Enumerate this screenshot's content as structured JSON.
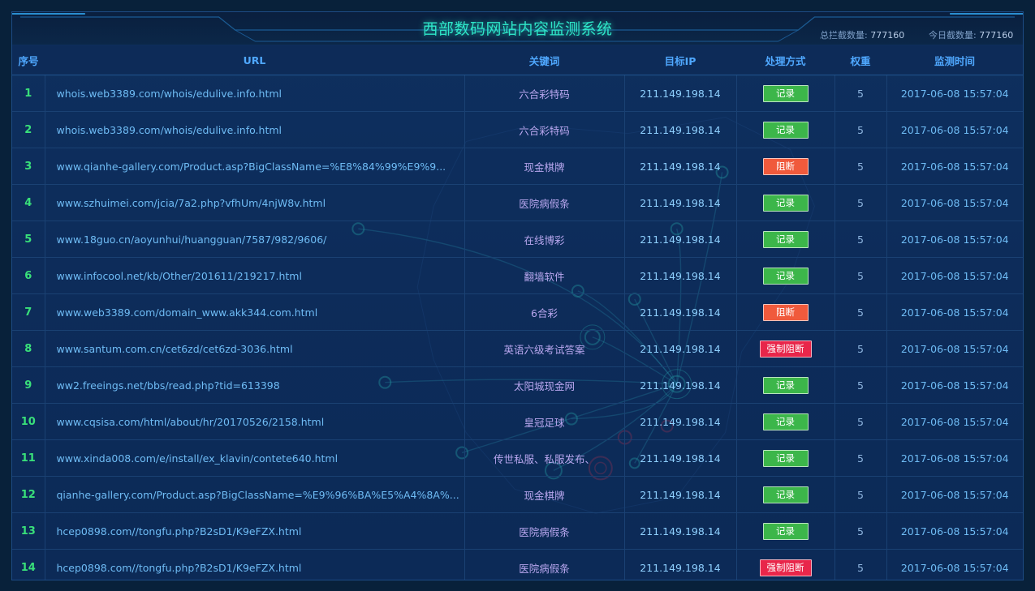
{
  "header": {
    "title": "西部数码网站内容监测系统",
    "total_label": "总拦截数量:",
    "total_value": "777160",
    "today_label": "今日截数量:",
    "today_value": "777160"
  },
  "table": {
    "columns": [
      "序号",
      "URL",
      "关键词",
      "目标IP",
      "处理方式",
      "权重",
      "监测时间"
    ],
    "rows": [
      {
        "no": "1",
        "url": "whois.web3389.com/whois/edulive.info.html",
        "keyword": "六合彩特码",
        "ip": "211.149.198.14",
        "action": "记录",
        "action_type": "record",
        "weight": "5",
        "time": "2017-06-08 15:57:04"
      },
      {
        "no": "2",
        "url": "whois.web3389.com/whois/edulive.info.html",
        "keyword": "六合彩特码",
        "ip": "211.149.198.14",
        "action": "记录",
        "action_type": "record",
        "weight": "5",
        "time": "2017-06-08 15:57:04"
      },
      {
        "no": "3",
        "url": "www.qianhe-gallery.com/Product.asp?BigClassName=%E8%84%99%E9%9...",
        "keyword": "现金棋牌",
        "ip": "211.149.198.14",
        "action": "阻断",
        "action_type": "block",
        "weight": "5",
        "time": "2017-06-08 15:57:04"
      },
      {
        "no": "4",
        "url": "www.szhuimei.com/jcia/7a2.php?vfhUm/4njW8v.html",
        "keyword": "医院病假条",
        "ip": "211.149.198.14",
        "action": "记录",
        "action_type": "record",
        "weight": "5",
        "time": "2017-06-08 15:57:04"
      },
      {
        "no": "5",
        "url": "www.18guo.cn/aoyunhui/huangguan/7587/982/9606/",
        "keyword": "在线博彩",
        "ip": "211.149.198.14",
        "action": "记录",
        "action_type": "record",
        "weight": "5",
        "time": "2017-06-08 15:57:04"
      },
      {
        "no": "6",
        "url": "www.infocool.net/kb/Other/201611/219217.html",
        "keyword": "翻墙软件",
        "ip": "211.149.198.14",
        "action": "记录",
        "action_type": "record",
        "weight": "5",
        "time": "2017-06-08 15:57:04"
      },
      {
        "no": "7",
        "url": "www.web3389.com/domain_www.akk344.com.html",
        "keyword": "6合彩",
        "ip": "211.149.198.14",
        "action": "阻断",
        "action_type": "block",
        "weight": "5",
        "time": "2017-06-08 15:57:04"
      },
      {
        "no": "8",
        "url": "www.santum.com.cn/cet6zd/cet6zd-3036.html",
        "keyword": "英语六级考试答案",
        "ip": "211.149.198.14",
        "action": "强制阻断",
        "action_type": "force",
        "weight": "5",
        "time": "2017-06-08 15:57:04"
      },
      {
        "no": "9",
        "url": "ww2.freeings.net/bbs/read.php?tid=613398",
        "keyword": "太阳城现金网",
        "ip": "211.149.198.14",
        "action": "记录",
        "action_type": "record",
        "weight": "5",
        "time": "2017-06-08 15:57:04"
      },
      {
        "no": "10",
        "url": "www.cqsisa.com/html/about/hr/20170526/2158.html",
        "keyword": "皇冠足球",
        "ip": "211.149.198.14",
        "action": "记录",
        "action_type": "record",
        "weight": "5",
        "time": "2017-06-08 15:57:04"
      },
      {
        "no": "11",
        "url": "www.xinda008.com/e/install/ex_klavin/contete640.html",
        "keyword": "传世私服、私服发布、",
        "ip": "211.149.198.14",
        "action": "记录",
        "action_type": "record",
        "weight": "5",
        "time": "2017-06-08 15:57:04"
      },
      {
        "no": "12",
        "url": "qianhe-gallery.com/Product.asp?BigClassName=%E9%96%BA%E5%A4%8A%...",
        "keyword": "现金棋牌",
        "ip": "211.149.198.14",
        "action": "记录",
        "action_type": "record",
        "weight": "5",
        "time": "2017-06-08 15:57:04"
      },
      {
        "no": "13",
        "url": "hcep0898.com//tongfu.php?B2sD1/K9eFZX.html",
        "keyword": "医院病假条",
        "ip": "211.149.198.14",
        "action": "记录",
        "action_type": "record",
        "weight": "5",
        "time": "2017-06-08 15:57:04"
      },
      {
        "no": "14",
        "url": "hcep0898.com//tongfu.php?B2sD1/K9eFZX.html",
        "keyword": "医院病假条",
        "ip": "211.149.198.14",
        "action": "强制阻断",
        "action_type": "force",
        "weight": "5",
        "time": "2017-06-08 15:57:04"
      }
    ]
  },
  "colors": {
    "accent_title": "#2ee6c8",
    "header_text": "#4fa8ff",
    "index_text": "#39e07a",
    "record": "#3cb64a",
    "block": "#f05a3c",
    "force": "#e8264a"
  }
}
